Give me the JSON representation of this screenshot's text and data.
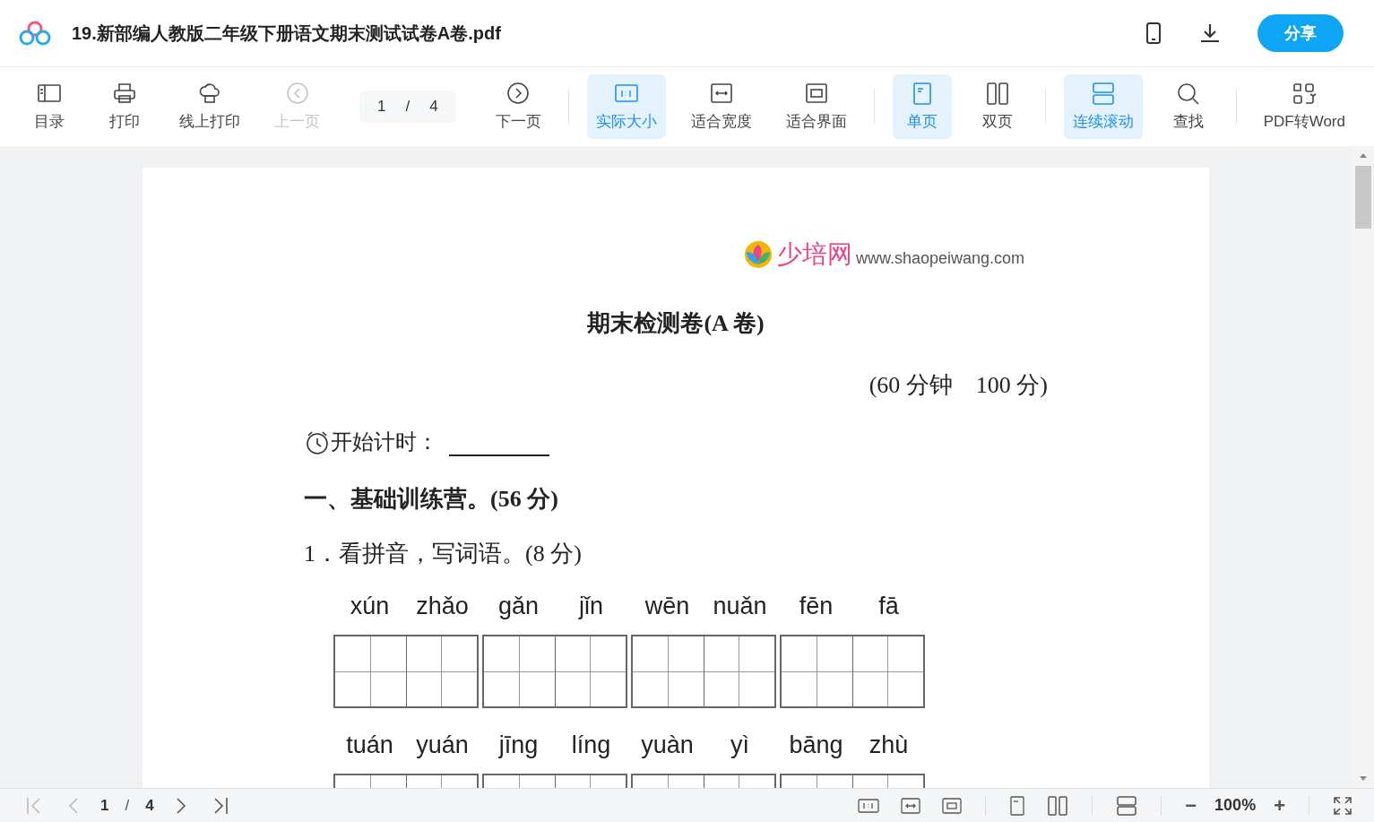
{
  "header": {
    "title": "19.新部编人教版二年级下册语文期末测试试卷A卷.pdf",
    "share_button": "分享"
  },
  "toolbar": {
    "groups": [
      [
        {
          "kind": "button",
          "label": "目录",
          "disabled": false,
          "selected": false
        },
        {
          "kind": "button",
          "label": "打印",
          "disabled": false,
          "selected": false
        },
        {
          "kind": "button",
          "label": "线上打印",
          "disabled": false,
          "selected": false
        },
        {
          "kind": "button",
          "label": "上一页",
          "disabled": true,
          "selected": false
        },
        {
          "kind": "page",
          "current": "1",
          "separator": "/",
          "total": "4"
        },
        {
          "kind": "button",
          "label": "下一页",
          "disabled": false,
          "selected": false
        }
      ],
      [
        {
          "kind": "button",
          "label": "实际大小",
          "disabled": false,
          "selected": true
        },
        {
          "kind": "button",
          "label": "适合宽度",
          "disabled": false,
          "selected": false
        },
        {
          "kind": "button",
          "label": "适合界面",
          "disabled": false,
          "selected": false
        }
      ],
      [
        {
          "kind": "button",
          "label": "单页",
          "disabled": false,
          "selected": true
        },
        {
          "kind": "button",
          "label": "双页",
          "disabled": false,
          "selected": false
        }
      ],
      [
        {
          "kind": "button",
          "label": "连续滚动",
          "disabled": false,
          "selected": true
        },
        {
          "kind": "button",
          "label": "查找",
          "disabled": false,
          "selected": false
        }
      ],
      [
        {
          "kind": "button",
          "label": "PDF转Word",
          "disabled": false,
          "selected": false
        }
      ]
    ]
  },
  "document": {
    "logo_text": "少培网",
    "url": "www.shaopeiwang.com",
    "title": "期末检测卷(A 卷)",
    "duration": "(60 分钟　100 分)",
    "timer_label": "开始计时：",
    "section": "一、基础训练营。(56 分)",
    "question": "1．看拼音，写词语。(8 分)",
    "pinyin_rows": [
      [
        "xún",
        "zhǎo",
        "gǎn",
        "jǐn",
        "wēn",
        "nuǎn",
        "fēn",
        "fā"
      ],
      [
        "tuán",
        "yuán",
        "jīng",
        "líng",
        "yuàn",
        "yì",
        "bāng",
        "zhù"
      ]
    ]
  },
  "bottom_bar": {
    "current_page": "1",
    "separator": "/",
    "total_pages": "4",
    "zoom": "100%",
    "minus": "−",
    "plus": "+"
  }
}
